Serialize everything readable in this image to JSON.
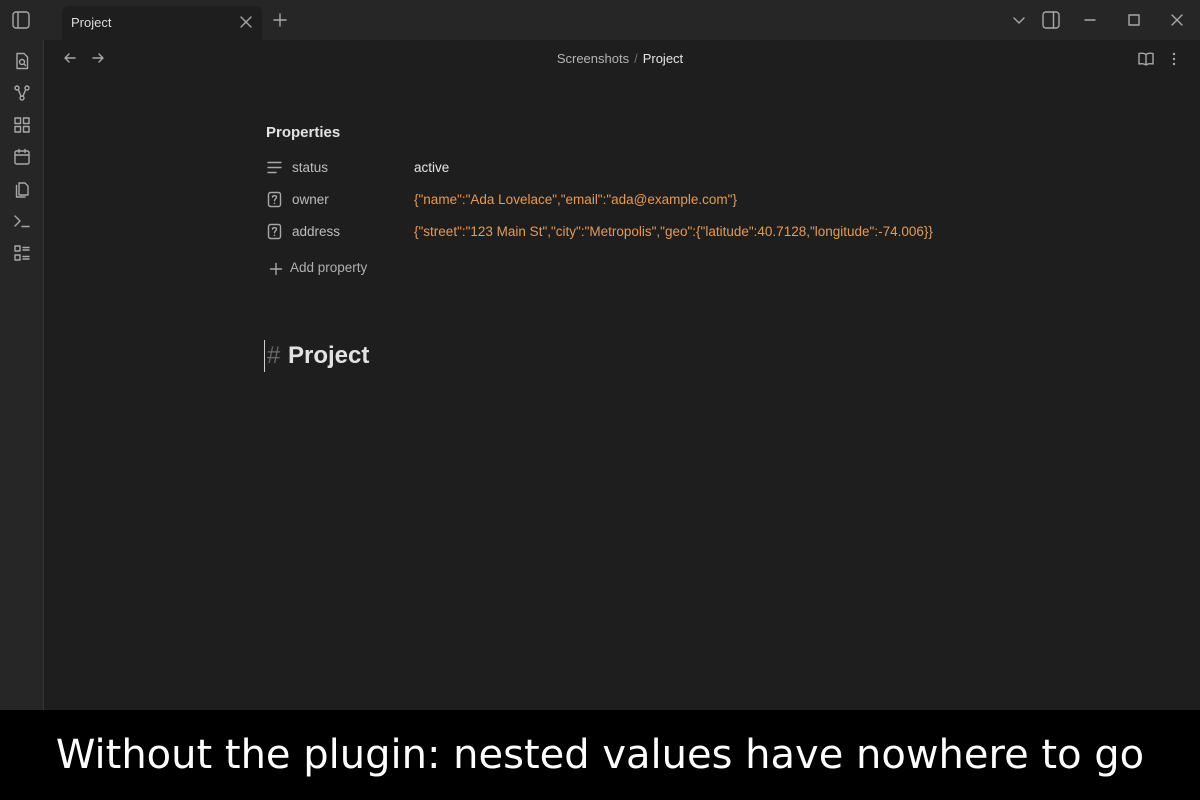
{
  "tab": {
    "label": "Project"
  },
  "breadcrumb": {
    "parent": "Screenshots",
    "separator": "/",
    "current": "Project"
  },
  "properties": {
    "title": "Properties",
    "items": [
      {
        "icon": "text-lines-icon",
        "key": "status",
        "value": "active",
        "kind": "text"
      },
      {
        "icon": "unknown-type-icon",
        "key": "owner",
        "value": "{\"name\":\"Ada Lovelace\",\"email\":\"ada@example.com\"}",
        "kind": "json"
      },
      {
        "icon": "unknown-type-icon",
        "key": "address",
        "value": "{\"street\":\"123 Main St\",\"city\":\"Metropolis\",\"geo\":{\"latitude\":40.7128,\"longitude\":-74.006}}",
        "kind": "json"
      }
    ],
    "add_label": "Add property"
  },
  "heading": {
    "mark": "#",
    "text": "Project"
  },
  "caption": "Without the plugin: nested values have nowhere to go",
  "colors": {
    "json_value": "#e39a5a",
    "background": "#1e1e1e",
    "chrome": "#262626"
  }
}
